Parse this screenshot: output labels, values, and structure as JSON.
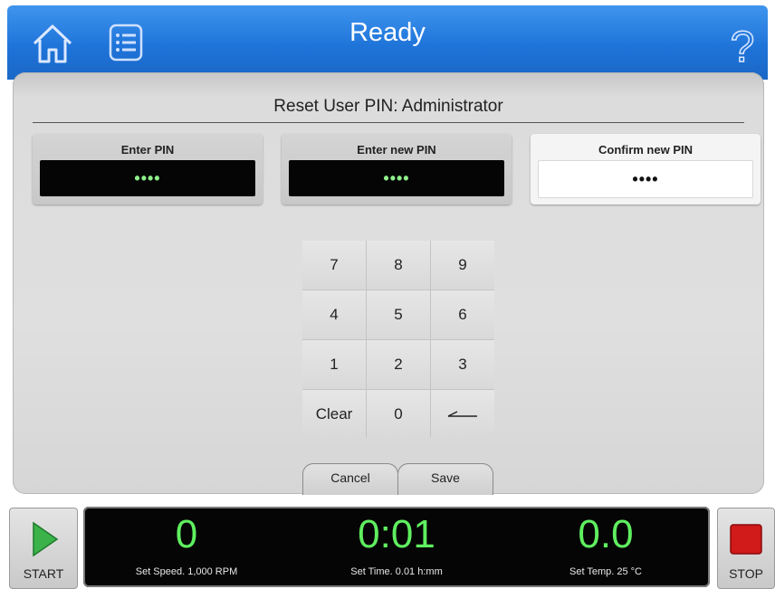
{
  "header": {
    "title": "Ready",
    "home_icon": "home-icon",
    "menu_icon": "menu-list-icon",
    "help_icon": "question-mark-icon",
    "help_glyph": "?"
  },
  "panel": {
    "title": "Reset User PIN: Administrator",
    "fields": [
      {
        "label": "Enter PIN",
        "value": "••••",
        "active": false
      },
      {
        "label": "Enter new PIN",
        "value": "••••",
        "active": false
      },
      {
        "label": "Confirm new PIN",
        "value": "••••",
        "active": true
      }
    ]
  },
  "keypad": {
    "keys": [
      "7",
      "8",
      "9",
      "4",
      "5",
      "6",
      "1",
      "2",
      "3",
      "Clear",
      "0"
    ],
    "backspace_icon": "backspace-arrow-icon"
  },
  "actions": {
    "cancel_label": "Cancel",
    "save_label": "Save"
  },
  "footer": {
    "start_label": "START",
    "stop_label": "STOP",
    "speed": {
      "value": "0",
      "setpoint": "Set Speed. 1,000 RPM"
    },
    "time": {
      "value": "0:01",
      "setpoint": "Set Time. 0.01 h:mm"
    },
    "temp": {
      "value": "0.0",
      "setpoint": "Set Temp. 25 °C"
    }
  },
  "colors": {
    "header_blue": "#1f74d9",
    "pin_green": "#8ff08a",
    "status_green": "#5fef5f",
    "start_green": "#3bb34a",
    "stop_red": "#d11a1a"
  }
}
